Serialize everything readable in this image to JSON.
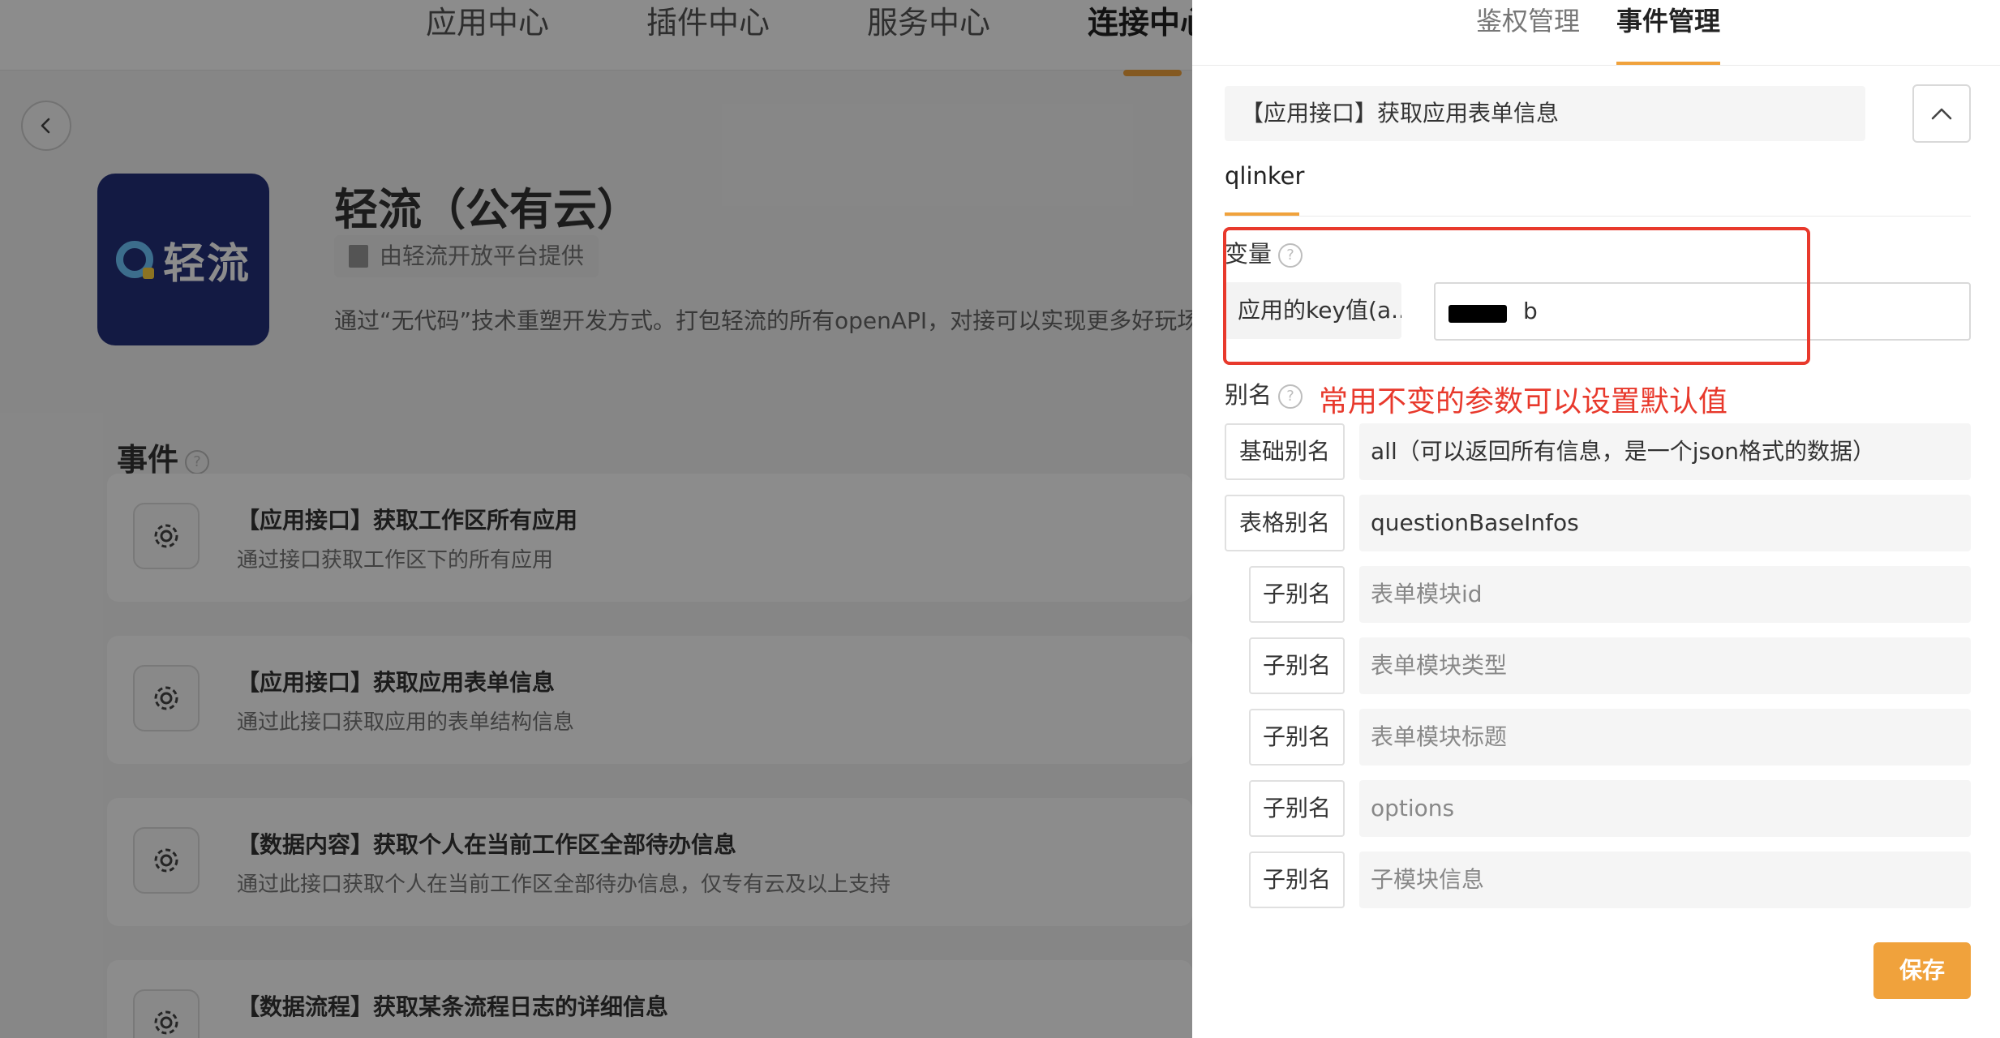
{
  "topnav": {
    "tabs": [
      {
        "label": "应用中心"
      },
      {
        "label": "插件中心"
      },
      {
        "label": "服务中心"
      },
      {
        "label": "连接中心"
      }
    ]
  },
  "app": {
    "logo_text": "轻流",
    "title": "轻流（公有云）",
    "provider": "由轻流开放平台提供",
    "description": "通过“无代码”技术重塑开发方式。打包轻流的所有openAPI，对接可以实现更多好玩场"
  },
  "events_section": {
    "title": "事件",
    "items": [
      {
        "title": "【应用接口】获取工作区所有应用",
        "desc": "通过接口获取工作区下的所有应用"
      },
      {
        "title": "【应用接口】获取应用表单信息",
        "desc": "通过此接口获取应用的表单结构信息"
      },
      {
        "title": "【数据内容】获取个人在当前工作区全部待办信息",
        "desc": "通过此接口获取个人在当前工作区全部待办信息，仅专有云及以上支持"
      },
      {
        "title": "【数据流程】获取某条流程日志的详细信息",
        "desc": ""
      }
    ]
  },
  "drawer": {
    "tabs": [
      {
        "label": "鉴权管理"
      },
      {
        "label": "事件管理"
      }
    ],
    "selected_event": "【应用接口】获取应用表单信息",
    "subtab": "qlinker",
    "variables": {
      "label": "变量",
      "key_label": "应用的key值(a...",
      "key_value": "b"
    },
    "alias": {
      "label": "别名",
      "annotation": "常用不变的参数可以设置默认值",
      "rows": [
        {
          "label": "基础别名",
          "value": "all（可以返回所有信息，是一个json格式的数据）"
        },
        {
          "label": "表格别名",
          "value": "questionBaseInfos"
        },
        {
          "label": "子别名",
          "placeholder": "表单模块id"
        },
        {
          "label": "子别名",
          "placeholder": "表单模块类型"
        },
        {
          "label": "子别名",
          "placeholder": "表单模块标题"
        },
        {
          "label": "子别名",
          "placeholder": "options"
        },
        {
          "label": "子别名",
          "placeholder": "子模块信息"
        }
      ]
    },
    "save_label": "保存"
  },
  "colors": {
    "accent": "#f0a23c",
    "annotation": "#e8392c",
    "logo_bg": "#24307a"
  }
}
